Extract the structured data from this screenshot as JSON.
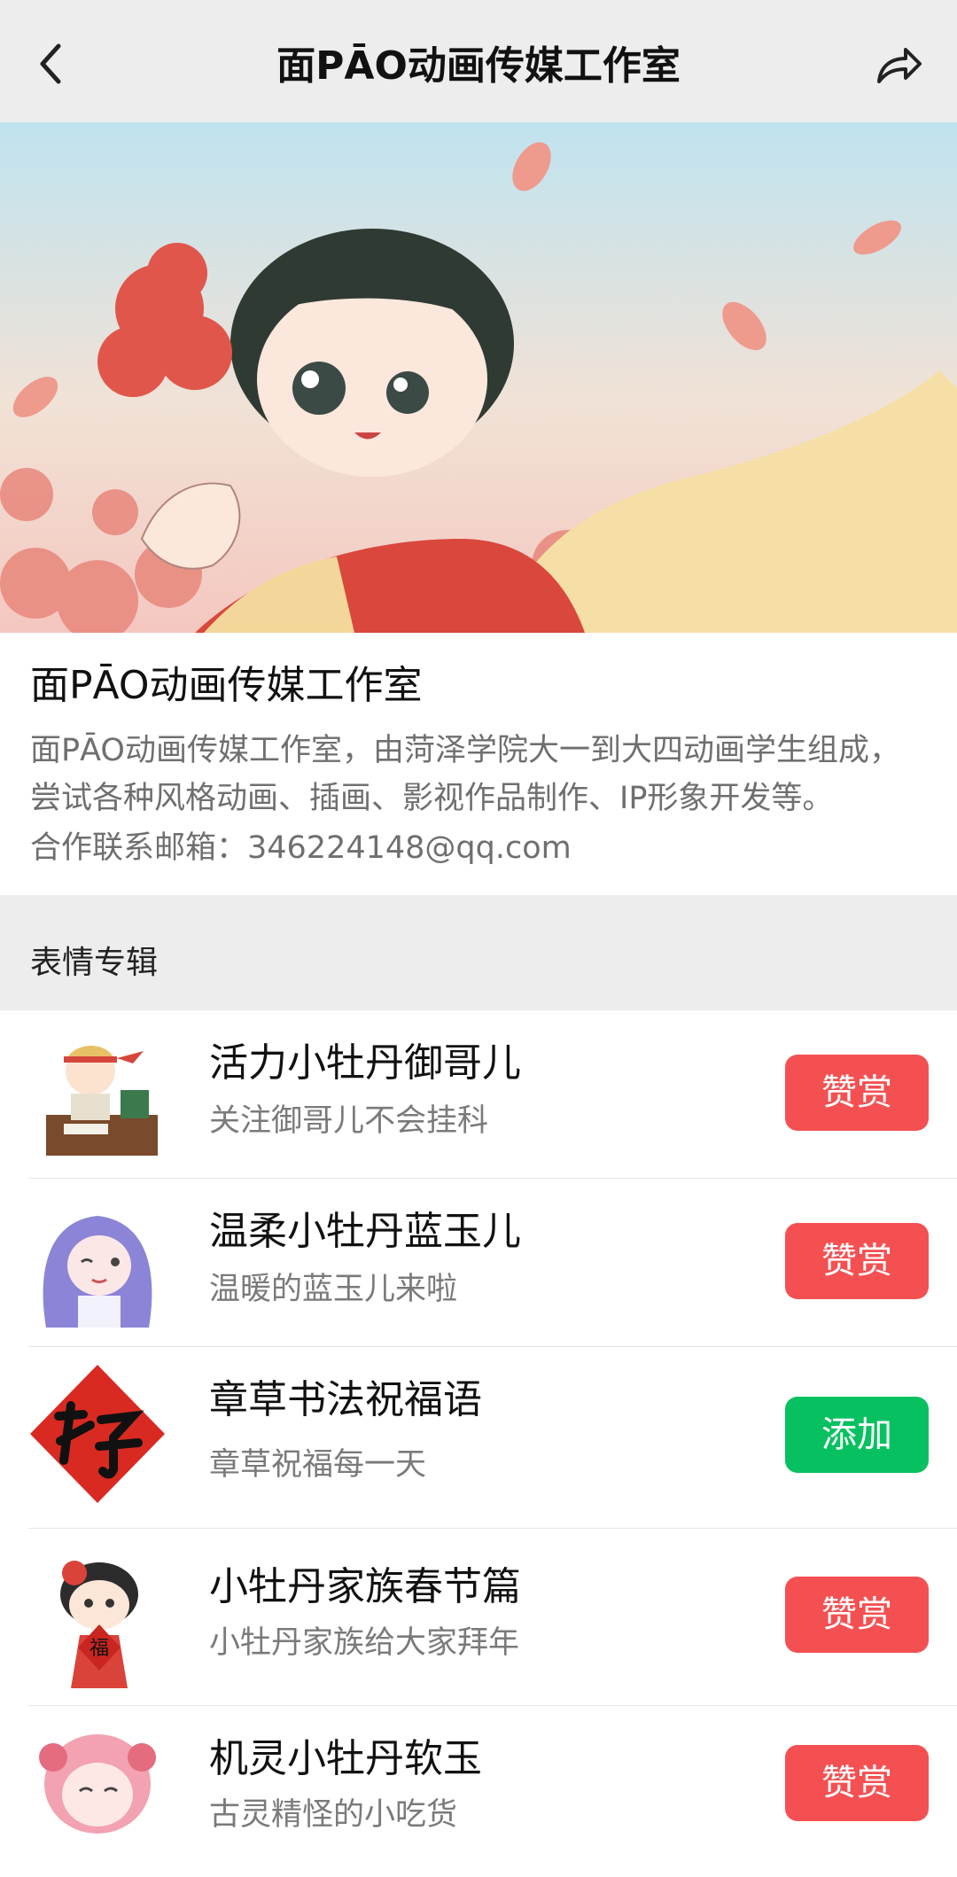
{
  "nav": {
    "title": "面PĀO动画传媒工作室",
    "back_icon": "chevron-left-icon",
    "share_icon": "share-arrow-icon"
  },
  "profile": {
    "name": "面PĀO动画传媒工作室",
    "description": "面PĀO动画传媒工作室，由菏泽学院大一到大四动画学生组成，尝试各种风格动画、插画、影视作品制作、IP形象开发等。",
    "contact": "合作联系邮箱：346224148@qq.com"
  },
  "section": {
    "title": "表情专辑"
  },
  "albums": [
    {
      "name": "活力小牡丹御哥儿",
      "subtitle": "关注御哥儿不会挂科",
      "button": "赞赏",
      "button_color": "#f45052"
    },
    {
      "name": "温柔小牡丹蓝玉儿",
      "subtitle": "温暖的蓝玉儿来啦",
      "button": "赞赏",
      "button_color": "#f45052"
    },
    {
      "name": "章草书法祝福语",
      "subtitle": "章草祝福每一天",
      "button": "添加",
      "button_color": "#07c160"
    },
    {
      "name": "小牡丹家族春节篇",
      "subtitle": "小牡丹家族给大家拜年",
      "button": "赞赏",
      "button_color": "#f45052"
    },
    {
      "name": "机灵小牡丹软玉",
      "subtitle": "古灵精怪的小吃货",
      "button": "赞赏",
      "button_color": "#f45052"
    }
  ],
  "colors": {
    "nav_bg": "#ededed",
    "reward_red": "#f45052",
    "add_green": "#07c160"
  }
}
